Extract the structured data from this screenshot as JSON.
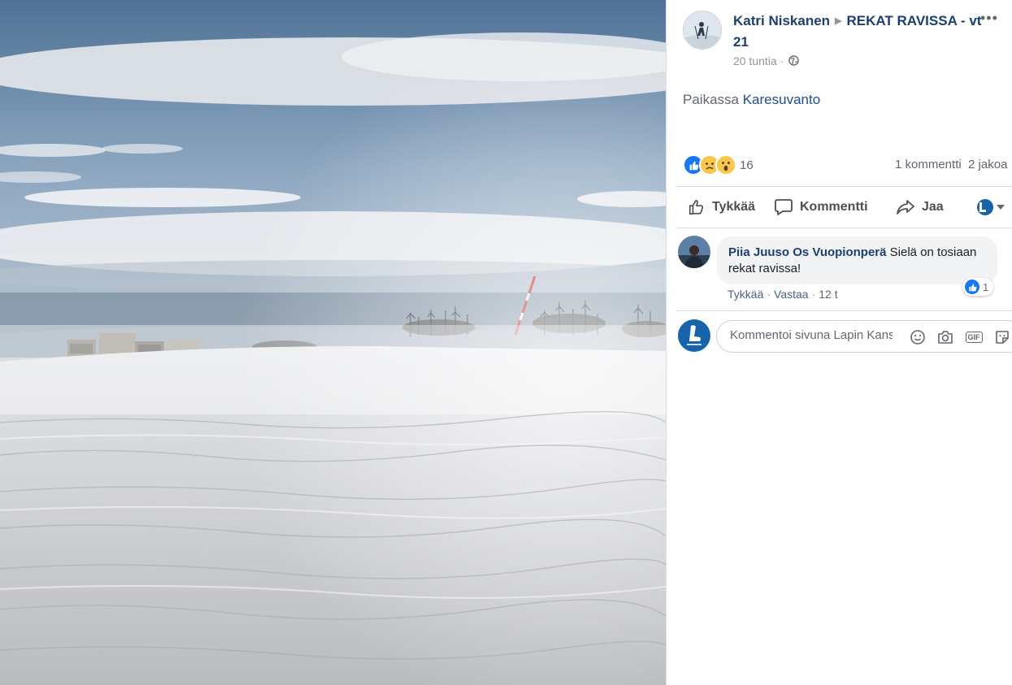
{
  "post": {
    "author": "Katri Niskanen",
    "group": "REKAT RAVISSA - vt 21",
    "time": "20 tuntia",
    "time_separator": "·",
    "place_prefix": "Paikassa",
    "place_link": "Karesuvanto",
    "reaction_count": "16",
    "comments_count": "1 kommentti",
    "shares_count": "2 jakoa",
    "more_icon": "more-dots-icon"
  },
  "actions": {
    "like": "Tykkää",
    "comment": "Kommentti",
    "share": "Jaa"
  },
  "comment": {
    "name": "Piia Juuso Os Vuopionperä",
    "text": "Sielä on tosiaan rekat ravissa!",
    "like_count": "1",
    "like_action": "Tykkää",
    "reply_action": "Vastaa",
    "time": "12 t",
    "separator": "·"
  },
  "composer": {
    "placeholder": "Kommentoi sivuna Lapin Kansa"
  },
  "colors": {
    "accent": "#1877f2",
    "name_link": "#1c3f70",
    "secondary_text": "#606770"
  }
}
